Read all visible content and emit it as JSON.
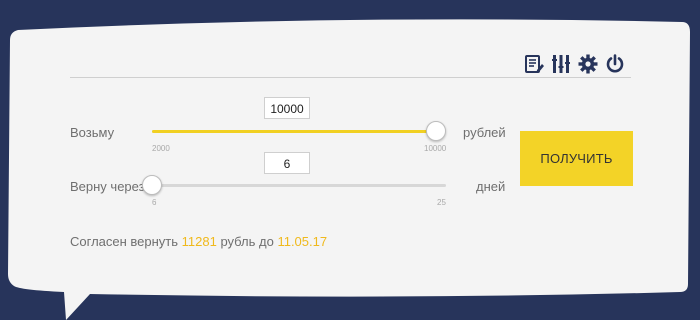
{
  "colors": {
    "background": "#27345b",
    "panel": "#f4f4f4",
    "accent": "#f3d327",
    "highlight_text": "#f0b91c",
    "label_text": "#6f6f6f"
  },
  "toolbar": {
    "icons": [
      "document-edit-icon",
      "tools-icon",
      "gear-icon",
      "power-icon"
    ]
  },
  "amount": {
    "label": "Возьму",
    "value": "10000",
    "unit": "рублей",
    "min_label": "2000",
    "max_label": "10000",
    "min": 2000,
    "max": 10000,
    "current": 10000
  },
  "term": {
    "label": "Верну через",
    "value": "6",
    "unit": "дней",
    "min_label": "6",
    "max_label": "25",
    "min": 6,
    "max": 25,
    "current": 6
  },
  "submit_label": "ПОЛУЧИТЬ",
  "agreement": {
    "prefix": "Согласен вернуть ",
    "sum": "11281",
    "middle": " рубль до ",
    "date": "11.05.17"
  }
}
